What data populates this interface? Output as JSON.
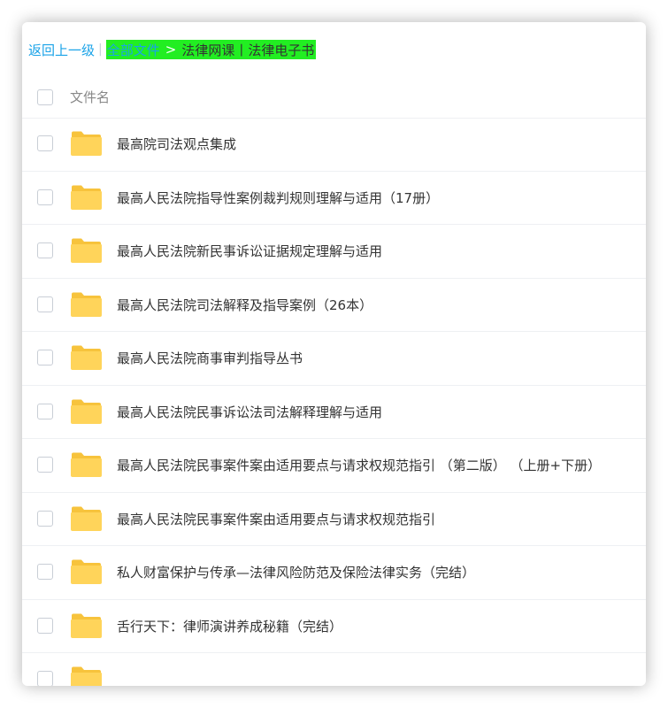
{
  "breadcrumb": {
    "back": "返回上一级",
    "separator": "|",
    "all_files": "全部文件",
    "arrow": ">",
    "current": "法律网课丨法律电子书",
    "highlight_color": "#22ee22"
  },
  "list_header": {
    "name_label": "文件名"
  },
  "files": [
    {
      "name": "最高院司法观点集成",
      "icon": "folder-icon"
    },
    {
      "name": "最高人民法院指导性案例裁判规则理解与适用（17册）",
      "icon": "folder-icon"
    },
    {
      "name": "最高人民法院新民事诉讼证据规定理解与适用",
      "icon": "folder-icon"
    },
    {
      "name": "最高人民法院司法解释及指导案例（26本）",
      "icon": "folder-icon"
    },
    {
      "name": "最高人民法院商事审判指导丛书",
      "icon": "folder-icon"
    },
    {
      "name": "最高人民法院民事诉讼法司法解释理解与适用",
      "icon": "folder-icon"
    },
    {
      "name": "最高人民法院民事案件案由适用要点与请求权规范指引 （第二版） （上册+下册）",
      "icon": "folder-icon"
    },
    {
      "name": "最高人民法院民事案件案由适用要点与请求权规范指引",
      "icon": "folder-icon"
    },
    {
      "name": "私人财富保护与传承—法律风险防范及保险法律实务（完结）",
      "icon": "folder-icon"
    },
    {
      "name": "舌行天下：律师演讲养成秘籍（完结）",
      "icon": "folder-icon"
    },
    {
      "name": "",
      "icon": "folder-icon"
    }
  ]
}
